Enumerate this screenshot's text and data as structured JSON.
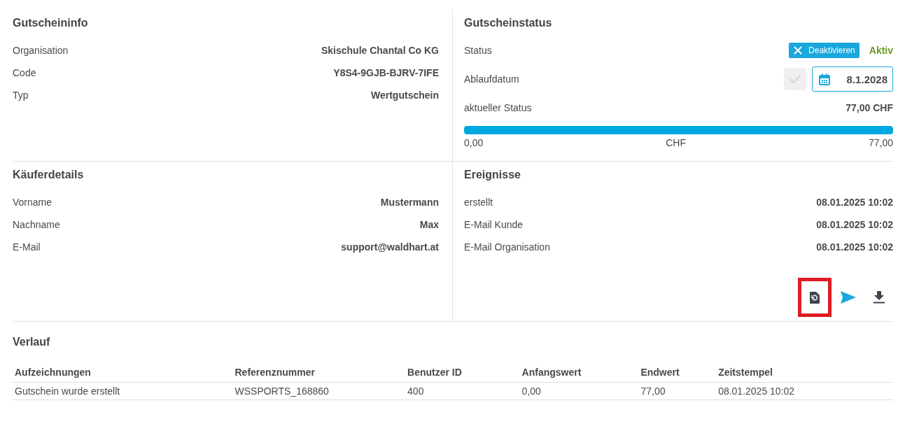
{
  "gutscheininfo": {
    "title": "Gutscheininfo",
    "rows": [
      {
        "label": "Organisation",
        "value": "Skischule Chantal Co KG"
      },
      {
        "label": "Code",
        "value": "Y8S4-9GJB-BJRV-7IFE"
      },
      {
        "label": "Typ",
        "value": "Wertgutschein"
      }
    ]
  },
  "gutscheinstatus": {
    "title": "Gutscheinstatus",
    "status": {
      "label": "Status",
      "button": "Deaktivieren",
      "state_text": "Aktiv"
    },
    "expiry": {
      "label": "Ablaufdatum",
      "value": "8.1.2028",
      "confirm_disabled": true
    },
    "current": {
      "label": "aktueller Status",
      "value": "77,00 CHF"
    },
    "progress": {
      "level": 1,
      "min": "0,00",
      "unit": "CHF",
      "max": "77,00"
    }
  },
  "kaeuferdetails": {
    "title": "Käuferdetails",
    "rows": [
      {
        "label": "Vorname",
        "value": "Mustermann"
      },
      {
        "label": "Nachname",
        "value": "Max"
      },
      {
        "label": "E-Mail",
        "value": "support@waldhart.at"
      }
    ]
  },
  "ereignisse": {
    "title": "Ereignisse",
    "rows": [
      {
        "label": "erstellt",
        "value": "08.01.2025 10:02"
      },
      {
        "label": "E-Mail Kunde",
        "value": "08.01.2025 10:02"
      },
      {
        "label": "E-Mail Organisation",
        "value": "08.01.2025 10:02"
      }
    ],
    "actions": [
      {
        "kind": "reset",
        "highlighted": true
      },
      {
        "kind": "send",
        "highlighted": false
      },
      {
        "kind": "download",
        "highlighted": false
      }
    ]
  },
  "verlauf": {
    "title": "Verlauf",
    "columns": [
      "Aufzeichnungen",
      "Referenznummer",
      "Benutzer ID",
      "Anfangswert",
      "Endwert",
      "Zeitstempel"
    ],
    "rows": [
      [
        "Gutschein wurde erstellt",
        "WSSPORTS_168860",
        "400",
        "0,00",
        "77,00",
        "08.01.2025 10:02"
      ]
    ]
  }
}
